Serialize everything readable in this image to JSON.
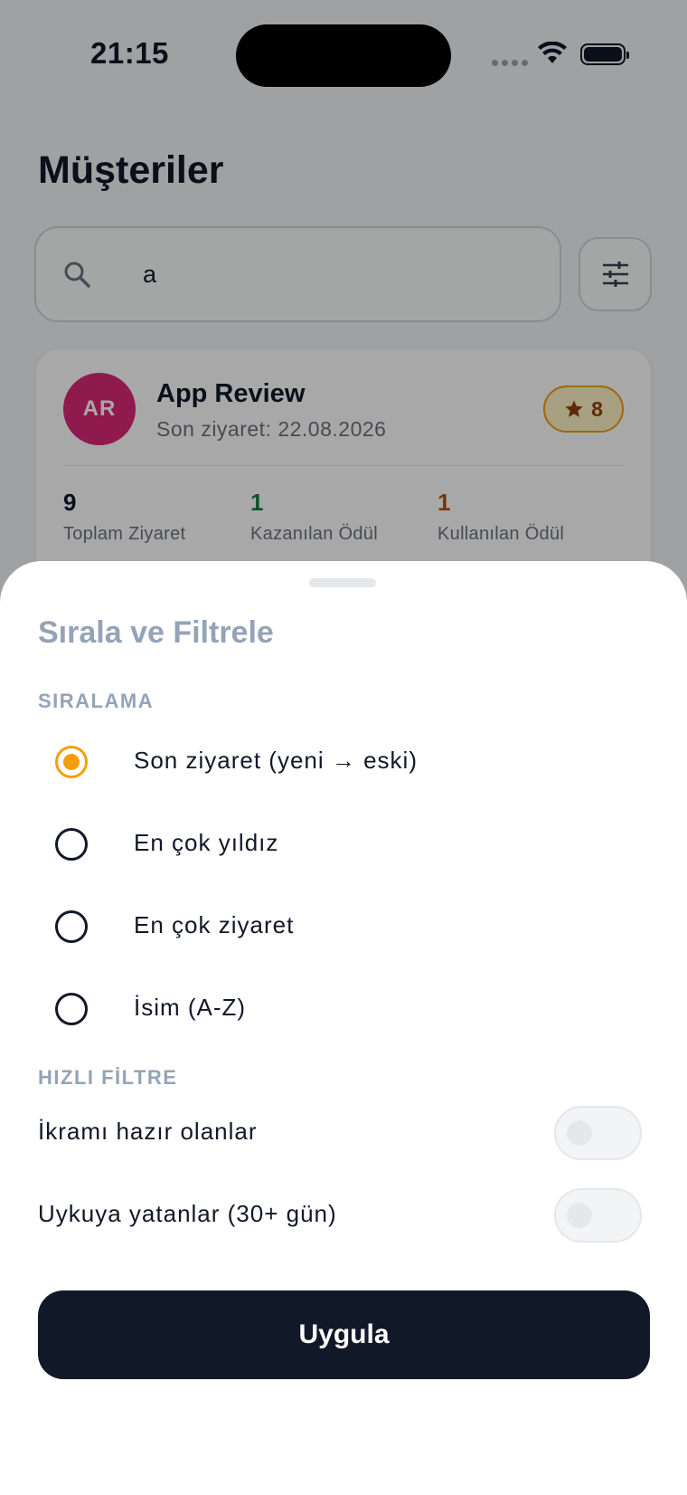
{
  "status_bar": {
    "time": "21:15"
  },
  "page": {
    "title": "Müşteriler"
  },
  "search": {
    "value": "a",
    "icon": "search-icon"
  },
  "filter_button": {
    "icon": "sliders-icon"
  },
  "customer": {
    "initials": "AR",
    "name": "App Review",
    "last_visit": "Son ziyaret: 22.08.2026",
    "stars": "8",
    "stats": [
      {
        "value": "9",
        "label": "Toplam Ziyaret",
        "color": "#111827"
      },
      {
        "value": "1",
        "label": "Kazanılan Ödül",
        "color": "#15803d"
      },
      {
        "value": "1",
        "label": "Kullanılan Ödül",
        "color": "#b45309"
      }
    ]
  },
  "sheet": {
    "title": "Sırala ve Filtrele",
    "sort_section": "SIRALAMA",
    "sort_options": [
      {
        "label": "Son ziyaret (yeni → eski)",
        "selected": true
      },
      {
        "label": "En çok yıldız",
        "selected": false
      },
      {
        "label": "En çok ziyaret",
        "selected": false
      },
      {
        "label": "İsim (A-Z)",
        "selected": false
      }
    ],
    "filter_section": "HIZLI FİLTRE",
    "filters": [
      {
        "label": "İkramı hazır olanlar",
        "on": false
      },
      {
        "label": "Uykuya yatanlar (30+ gün)",
        "on": false
      }
    ],
    "apply_label": "Uygula"
  },
  "colors": {
    "accent": "#f59e0b",
    "primary": "#111827",
    "avatar": "#db2777"
  }
}
